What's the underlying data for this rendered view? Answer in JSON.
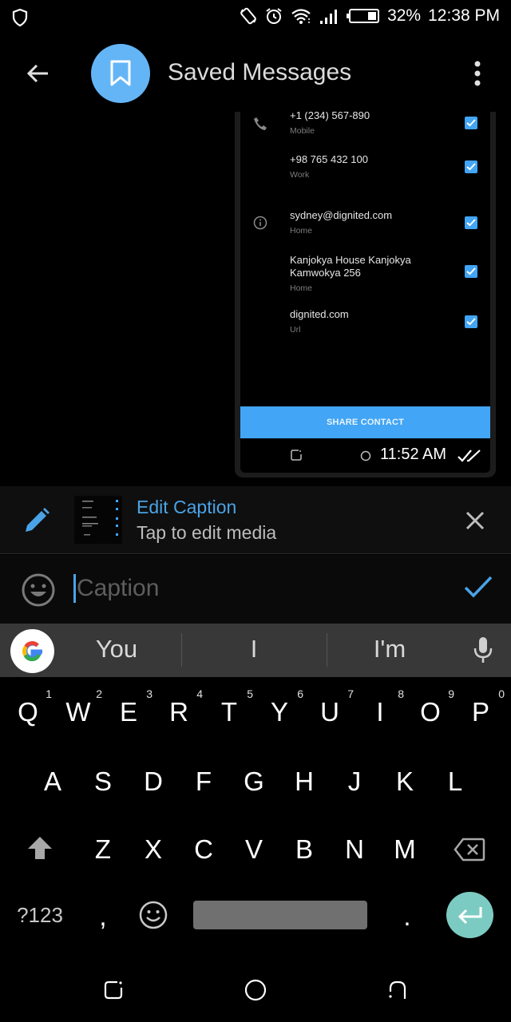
{
  "status_bar": {
    "battery_percent": "32%",
    "time": "12:38 PM",
    "icons": [
      "shield-icon",
      "auto-rotate-icon",
      "alarm-icon",
      "wifi-icon",
      "signal-icon",
      "battery-icon"
    ]
  },
  "app_bar": {
    "title": "Saved Messages",
    "back_icon": "arrow-left-icon",
    "avatar_icon": "bookmark-icon",
    "menu_icon": "more-vertical-icon"
  },
  "message": {
    "contact_rows": [
      {
        "value": "+1 (234) 567-890",
        "label": "Mobile",
        "icon": "phone-icon",
        "checked": true
      },
      {
        "value": "+98 765 432 100",
        "label": "Work",
        "icon": "",
        "checked": true
      },
      {
        "value": "sydney@dignited.com",
        "label": "Home",
        "icon": "info-icon",
        "checked": true
      },
      {
        "value": "Kanjokya House Kanjokya Kamwokya 256",
        "label": "Home",
        "icon": "",
        "checked": true
      },
      {
        "value": "dignited.com",
        "label": "Url",
        "icon": "",
        "checked": true
      }
    ],
    "share_button": "SHARE CONTACT",
    "time": "11:52 AM",
    "status_icon": "double-check-icon"
  },
  "edit_caption": {
    "title": "Edit Caption",
    "subtitle": "Tap to edit media",
    "accent_color": "#4aa3e6"
  },
  "caption_input": {
    "placeholder": "Caption",
    "value": ""
  },
  "keyboard": {
    "suggestions": [
      "You",
      "I",
      "I'm"
    ],
    "row1": [
      {
        "key": "Q",
        "hint": "1"
      },
      {
        "key": "W",
        "hint": "2"
      },
      {
        "key": "E",
        "hint": "3"
      },
      {
        "key": "R",
        "hint": "4"
      },
      {
        "key": "T",
        "hint": "5"
      },
      {
        "key": "Y",
        "hint": "6"
      },
      {
        "key": "U",
        "hint": "7"
      },
      {
        "key": "I",
        "hint": "8"
      },
      {
        "key": "O",
        "hint": "9"
      },
      {
        "key": "P",
        "hint": "0"
      }
    ],
    "row2": [
      "A",
      "S",
      "D",
      "F",
      "G",
      "H",
      "J",
      "K",
      "L"
    ],
    "row3": [
      "Z",
      "X",
      "C",
      "V",
      "B",
      "N",
      "M"
    ],
    "symbols_key": "?123",
    "comma_key": ",",
    "period_key": ".",
    "enter_color": "#7ccbc2"
  }
}
